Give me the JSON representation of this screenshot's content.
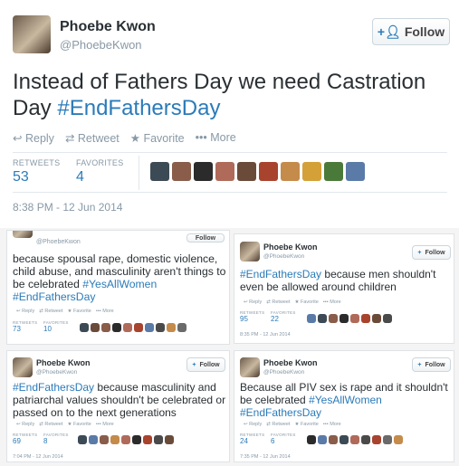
{
  "main": {
    "name": "Phoebe Kwon",
    "handle": "@PhoebeKwon",
    "follow": "Follow",
    "text_plain": "Instead of Fathers Day we need Castration Day",
    "text_hashtag": "#EndFathersDay",
    "actions": {
      "reply": "Reply",
      "retweet": "Retweet",
      "favorite": "Favorite",
      "more": "More"
    },
    "retweets_label": "RETWEETS",
    "retweets_value": "53",
    "favorites_label": "FAVORITES",
    "favorites_value": "4",
    "timestamp": "8:38 PM - 12 Jun 2014"
  },
  "card_a": {
    "name": "@PhoebeKwon",
    "follow": "Follow",
    "text1": "because spousal rape, domestic violence, child abuse, and masculinity aren't things to be celebrated",
    "hash1": "#YesAllWomen",
    "hash2": "#EndFathersDay",
    "actions": {
      "reply": "Reply",
      "retweet": "Retweet",
      "favorite": "Favorite",
      "more": "More"
    },
    "retweets_label": "RETWEETS",
    "retweets_value": "73",
    "favorites_label": "FAVORITES",
    "favorites_value": "10"
  },
  "card_b": {
    "name": "Phoebe Kwon",
    "handle": "@PhoebeKwon",
    "follow": "Follow",
    "hash1": "#EndFathersDay",
    "text1": "because men shouldn't even be allowed around children",
    "actions": {
      "reply": "Reply",
      "retweet": "Retweet",
      "favorite": "Favorite",
      "more": "More"
    },
    "retweets_label": "RETWEETS",
    "retweets_value": "95",
    "favorites_label": "FAVORITES",
    "favorites_value": "22",
    "timestamp": "8:35 PM - 12 Jun 2014"
  },
  "card_c": {
    "name": "Phoebe Kwon",
    "handle": "@PhoebeKwon",
    "follow": "Follow",
    "hash1": "#EndFathersDay",
    "text1": "because masculinity and patriarchal values shouldn't be celebrated or passed on to the next generations",
    "actions": {
      "reply": "Reply",
      "retweet": "Retweet",
      "favorite": "Favorite",
      "more": "More"
    },
    "retweets_label": "RETWEETS",
    "retweets_value": "69",
    "favorites_label": "FAVORITES",
    "favorites_value": "8",
    "timestamp": "7:04 PM - 12 Jun 2014"
  },
  "card_d": {
    "name": "Phoebe Kwon",
    "handle": "@PhoebeKwon",
    "follow": "Follow",
    "text1": "Because all PIV sex is rape and it shouldn't be celebrated",
    "hash1": "#YesAllWomen",
    "hash2": "#EndFathersDay",
    "actions": {
      "reply": "Reply",
      "retweet": "Retweet",
      "favorite": "Favorite",
      "more": "More"
    },
    "retweets_label": "RETWEETS",
    "retweets_value": "24",
    "favorites_label": "FAVORITES",
    "favorites_value": "6",
    "timestamp": "7:35 PM - 12 Jun 2014"
  },
  "colors": {
    "link": "#2b7bb9",
    "muted": "#8899a6",
    "text": "#292f33"
  }
}
